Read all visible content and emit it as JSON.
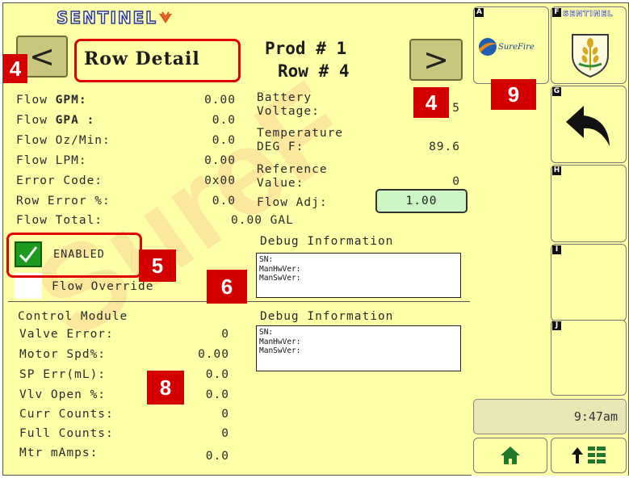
{
  "header": {
    "logo_text": "SENTINEL",
    "title": "Row Detail",
    "prod_label": "Prod # 1",
    "row_label": "Row # 4",
    "prev_symbol": "<",
    "next_symbol": ">"
  },
  "flow": [
    {
      "label": "Flow ",
      "label_bold": "GPM:",
      "value": "0.00"
    },
    {
      "label": "Flow ",
      "label_bold": "GPA :",
      "value": "0.0"
    },
    {
      "label": "Flow Oz/Min:",
      "label_bold": "",
      "value": "0.0"
    },
    {
      "label": "Flow LPM:",
      "label_bold": "",
      "value": "0.00"
    },
    {
      "label": "Error Code:",
      "label_bold": "",
      "value": "0x00"
    },
    {
      "label": "Row Error %:",
      "label_bold": "",
      "value": "0.0"
    }
  ],
  "flow_total": {
    "label": "Flow Total:",
    "value": "0.00 GAL"
  },
  "right_panel": {
    "battery_label_1": "Battery",
    "battery_label_2": "Voltage:",
    "battery_value": "5",
    "temp_label_1": "Temperature",
    "temp_label_2": "DEG F:",
    "temp_value": "89.6",
    "ref_label_1": "Reference",
    "ref_label_2": "Value:",
    "ref_value": "0",
    "flow_adj_label": "Flow Adj:",
    "flow_adj_value": "1.00"
  },
  "enabled": {
    "label": "ENABLED",
    "checked": true
  },
  "flow_override_label": "Flow Override",
  "debug1": {
    "title": "Debug Information",
    "lines": [
      "SN:",
      "ManHwVer:",
      "ManSwVer:"
    ]
  },
  "debug2": {
    "title": "Debug Information",
    "lines": [
      "SN:",
      "ManHwVer:",
      "ManSwVer:"
    ]
  },
  "control_module": {
    "title": "Control Module",
    "rows": [
      {
        "label": "Valve Error:",
        "value": "0"
      },
      {
        "label": "Motor Spd%:",
        "value": "0.00"
      },
      {
        "label": "SP Err(mL):",
        "value": "0.0"
      },
      {
        "label": "Vlv Open %:",
        "value": "0.0"
      },
      {
        "label": "Curr Counts:",
        "value": "0"
      },
      {
        "label": "Full Counts:",
        "value": "0"
      },
      {
        "label": "Mtr mAmps:",
        "value": "0.0"
      }
    ]
  },
  "softkeys": {
    "A": {
      "letter": "A",
      "logo_text": "SureFire"
    },
    "F": {
      "letter": "F",
      "logo_text": "SENTINEL"
    },
    "G": {
      "letter": "G",
      "icon": "back-arrow-icon"
    },
    "H": {
      "letter": "H"
    },
    "I": {
      "letter": "I"
    },
    "J": {
      "letter": "J"
    }
  },
  "clock": "9:47am",
  "callouts": {
    "c4a": "4",
    "c4b": "4",
    "c5": "5",
    "c6": "6",
    "c8": "8",
    "c9": "9"
  },
  "watermark_text": "SureF",
  "colors": {
    "background": "#ffffa8",
    "nav_button": "#c9c67e",
    "callout": "#d40000",
    "checkbox": "#1e9a1e",
    "flow_adj_box": "#ccf5c4"
  }
}
